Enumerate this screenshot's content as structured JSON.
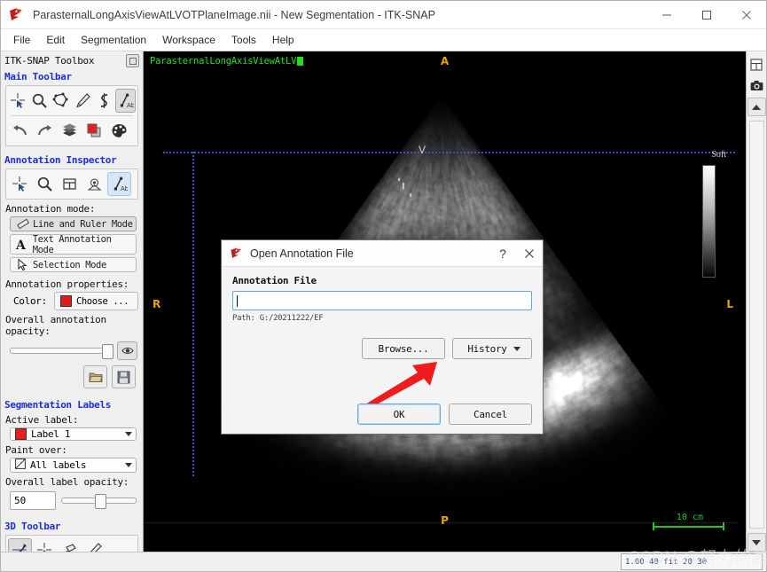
{
  "window": {
    "title": "ParasternalLongAxisViewAtLVOTPlaneImage.nii - New Segmentation - ITK-SNAP",
    "app_icon": "itk-snap-logo-icon",
    "minimize": "–",
    "maximize": "☐",
    "close": "✕"
  },
  "menubar": {
    "items": [
      {
        "label": "File"
      },
      {
        "label": "Edit"
      },
      {
        "label": "Segmentation"
      },
      {
        "label": "Workspace"
      },
      {
        "label": "Tools"
      },
      {
        "label": "Help"
      }
    ]
  },
  "sidebar": {
    "panel_title": "ITK-SNAP Toolbox",
    "float_button": "undock-icon",
    "main_toolbar": {
      "header": "Main Toolbar",
      "row1": [
        {
          "name": "crosshair-tool-icon",
          "active": false
        },
        {
          "name": "zoom-pan-tool-icon",
          "active": false
        },
        {
          "name": "polygon-tool-icon",
          "active": false
        },
        {
          "name": "paintbrush-tool-icon",
          "active": false
        },
        {
          "name": "snake-tool-icon",
          "active": false
        },
        {
          "name": "annotation-tool-icon",
          "active": true
        }
      ],
      "row2": [
        {
          "name": "undo-icon",
          "active": false
        },
        {
          "name": "redo-icon",
          "active": false
        },
        {
          "name": "layers-icon",
          "active": false
        },
        {
          "name": "label-color-icon",
          "active": false
        },
        {
          "name": "palette-icon",
          "active": false
        }
      ]
    },
    "annotation_inspector": {
      "header": "Annotation Inspector",
      "tabs": [
        {
          "name": "crosshair-tab-icon",
          "active": false
        },
        {
          "name": "zoom-tab-icon",
          "active": false
        },
        {
          "name": "grid-tab-icon",
          "active": false
        },
        {
          "name": "mesh-tab-icon",
          "active": false
        },
        {
          "name": "annotation-tab-icon",
          "active": true
        }
      ],
      "mode_label": "Annotation mode:",
      "modes": [
        {
          "label": "Line and Ruler Mode",
          "icon": "ruler-icon",
          "selected": true
        },
        {
          "label": "Text Annotation Mode",
          "icon": "text-A-icon",
          "selected": false
        },
        {
          "label": "Selection Mode",
          "icon": "cursor-arrow-icon",
          "selected": false
        }
      ],
      "properties_label": "Annotation properties:",
      "color_label": "Color:",
      "color_button": "Choose ...",
      "color_value": "#e01b1b",
      "opacity_label": "Overall annotation opacity:",
      "opacity_value": 100,
      "eye_icon": "eye-visibility-icon",
      "open_icon": "folder-open-icon",
      "save_icon": "floppy-save-icon"
    },
    "segmentation_labels": {
      "header": "Segmentation Labels",
      "active_label_caption": "Active label:",
      "active_label_value": "Label 1",
      "active_label_color": "#ef1b1b",
      "paint_over_caption": "Paint over:",
      "paint_over_value": "All labels",
      "paint_over_icon": "hatched-square-icon",
      "opacity_caption": "Overall label opacity:",
      "opacity_value": "50",
      "opacity_percent": 50
    },
    "toolbar_3d": {
      "header": "3D Toolbar",
      "buttons": [
        {
          "name": "3d-scalpel-icon",
          "active": true
        },
        {
          "name": "3d-crosshair-icon",
          "active": false
        },
        {
          "name": "3d-spray-icon",
          "active": false
        },
        {
          "name": "3d-knife-icon",
          "active": false
        }
      ]
    }
  },
  "viewport": {
    "annotation_text": "ParasternalLongAxisViewAtLV",
    "annotation_color": "#24e024",
    "orientation": {
      "top": "A",
      "bottom": "P",
      "left": "R",
      "right": "L",
      "color": "#e0a70c"
    },
    "vessel_marker": "V",
    "colorbar_label": "Soft",
    "scale_bar": "10 cm",
    "crosshair_color": "#3b4ecb"
  },
  "right_rail": {
    "buttons": [
      {
        "name": "layout-grid-icon"
      },
      {
        "name": "camera-snapshot-icon"
      },
      {
        "name": "scroll-up-icon"
      }
    ]
  },
  "statusbar": {
    "text": "1.00 40 fit 20 30"
  },
  "dialog": {
    "title": "Open Annotation File",
    "app_icon": "itk-snap-logo-icon",
    "help_button": "?",
    "close_button": "✕",
    "field_label": "Annotation File",
    "input_value": "",
    "input_placeholder": "",
    "path_text": "Path: G:/20211222/EF",
    "browse_button": "Browse...",
    "history_button": "History",
    "ok_button": "OK",
    "cancel_button": "Cancel",
    "pointer_annotation": "red-arrow-icon",
    "pointer_color": "#ee1c1c"
  },
  "watermark": {
    "text": "CSDN @努力的鑫"
  }
}
